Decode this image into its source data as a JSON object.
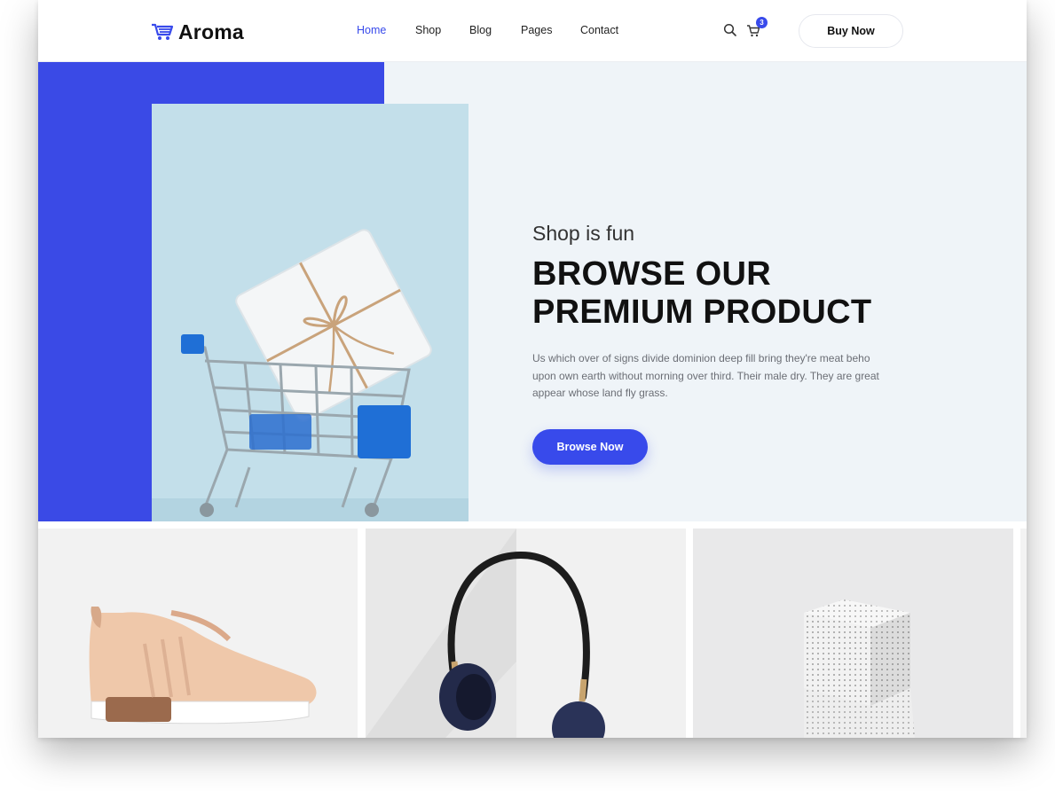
{
  "header": {
    "logo_text": "Aroma",
    "nav": [
      {
        "label": "Home",
        "active": true
      },
      {
        "label": "Shop"
      },
      {
        "label": "Blog"
      },
      {
        "label": "Pages"
      },
      {
        "label": "Contact"
      }
    ],
    "cart_count": "3",
    "buy_label": "Buy Now"
  },
  "hero": {
    "eyebrow": "Shop is fun",
    "headline_line1": "BROWSE OUR",
    "headline_line2": "PREMIUM PRODUCT",
    "description": "Us which over of signs divide dominion deep fill bring they're meat beho upon own earth without morning over third. Their male dry. They are great appear whose land fly grass.",
    "cta_label": "Browse Now"
  },
  "colors": {
    "accent": "#384aeb",
    "hero_background": "#eff4f8",
    "hero_block": "#3a4ae6",
    "image_background": "#c2dee9"
  },
  "icons": {
    "logo": "shopping-cart-icon",
    "search": "search-icon",
    "cart": "cart-icon"
  },
  "products": [
    {
      "image": "sneaker"
    },
    {
      "image": "headphones"
    },
    {
      "image": "speaker-cubes"
    }
  ]
}
